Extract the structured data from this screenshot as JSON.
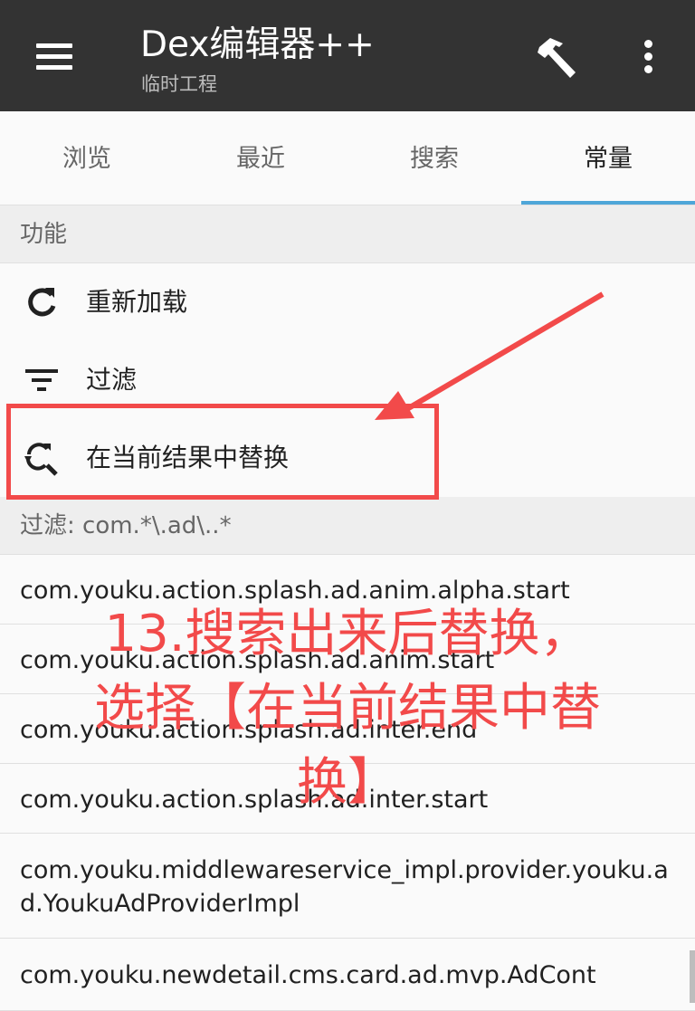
{
  "header": {
    "title": "Dex编辑器++",
    "subtitle": "临时工程",
    "icons": [
      "menu-icon",
      "hammer-icon",
      "more-vert-icon"
    ]
  },
  "tabs": [
    {
      "label": "浏览",
      "active": false
    },
    {
      "label": "最近",
      "active": false
    },
    {
      "label": "搜索",
      "active": false
    },
    {
      "label": "常量",
      "active": true
    }
  ],
  "functions": {
    "header": "功能",
    "items": [
      {
        "label": "重新加载",
        "icon": "reload-icon"
      },
      {
        "label": "过滤",
        "icon": "filter-icon"
      },
      {
        "label": "在当前结果中替换",
        "icon": "search-replace-icon"
      }
    ]
  },
  "filter_header": "过滤: com.*\\.ad\\..*",
  "results": [
    "com.youku.action.splash.ad.anim.alpha.start",
    "com.youku.action.splash.ad.anim.start",
    "com.youku.action.splash.ad.inter.end",
    "com.youku.action.splash.ad.inter.start",
    "com.youku.middlewareservice_impl.provider.youku.ad.YoukuAdProviderImpl",
    "com.youku.newdetail.cms.card.ad.mvp.AdCont"
  ],
  "annotation": {
    "line1": "13.搜索出来后替换，",
    "line2": "选择【在当前结果中替",
    "line3": "换】",
    "color": "#f24a4a"
  },
  "colors": {
    "appbar": "#333333",
    "tab_indicator": "#4ea6d8",
    "section_bg": "#eeeeee"
  }
}
